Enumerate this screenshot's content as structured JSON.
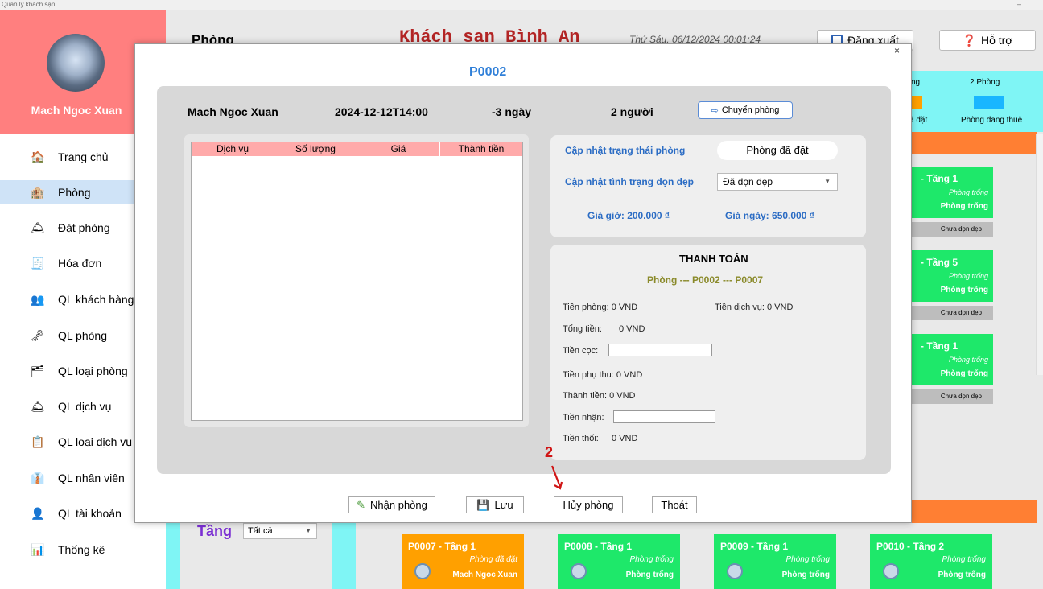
{
  "window": {
    "title": "Quản lý khách sạn",
    "minimize": "–"
  },
  "profile": {
    "name": "Mach Ngoc Xuan"
  },
  "sidebar": {
    "items": [
      {
        "label": "Trang chủ",
        "icon": "home-icon",
        "glyph": "🏠"
      },
      {
        "label": "Phòng",
        "icon": "room-icon",
        "glyph": "🏨"
      },
      {
        "label": "Đặt phòng",
        "icon": "booking-icon",
        "glyph": "🛎"
      },
      {
        "label": "Hóa đơn",
        "icon": "invoice-icon",
        "glyph": "🧾"
      },
      {
        "label": "QL khách hàng",
        "icon": "customers-icon",
        "glyph": "👥"
      },
      {
        "label": "QL phòng",
        "icon": "manage-rooms-icon",
        "glyph": "🗝"
      },
      {
        "label": "QL loại phòng",
        "icon": "room-types-icon",
        "glyph": "🗂"
      },
      {
        "label": "QL dịch vụ",
        "icon": "services-icon",
        "glyph": "🛎"
      },
      {
        "label": "QL loại dịch vụ",
        "icon": "service-types-icon",
        "glyph": "📋"
      },
      {
        "label": "QL nhân viên",
        "icon": "staff-icon",
        "glyph": "👔"
      },
      {
        "label": "QL tài khoản",
        "icon": "accounts-icon",
        "glyph": "👤"
      },
      {
        "label": "Thống kê",
        "icon": "stats-icon",
        "glyph": "📊"
      }
    ],
    "active_index": 1
  },
  "header": {
    "title": "Phòng",
    "hotel": "Khách san Bình An",
    "datetime": "Thứ Sáu, 06/12/2024 00:01:24",
    "logout": "Đăng xuất",
    "help": "Hỗ trợ"
  },
  "legend": {
    "label1": "ng",
    "label2": "2 Phòng",
    "label3": "ã đặt",
    "label4": "Phòng đang thuê",
    "color_booked": "#ffa000",
    "color_rented": "#19b6ff"
  },
  "right_cards": [
    {
      "title": "- Tầng 1",
      "status": "Phòng trống",
      "state": "Phòng trống",
      "clean": "Chưa dọn dẹp"
    },
    {
      "title": "- Tầng 5",
      "status": "Phòng trống",
      "state": "Phòng trống",
      "clean": "Chưa dọn dẹp"
    },
    {
      "title": "- Tầng 1",
      "status": "Phòng trống",
      "state": "Phòng trống",
      "clean": "Chưa dọn dẹp"
    }
  ],
  "floor_filter": {
    "label": "Tầng",
    "value": "Tất cả"
  },
  "bottom_cards": [
    {
      "title": "P0007 - Tầng 1",
      "status": "Phòng đã đặt",
      "name": "Mach Ngoc Xuan",
      "color": "#ffa000"
    },
    {
      "title": "P0008 - Tầng 1",
      "status": "Phòng trống",
      "name": "Phòng trống",
      "color": "#1ee86a"
    },
    {
      "title": "P0009 - Tầng 1",
      "status": "Phòng trống",
      "name": "Phòng trống",
      "color": "#1ee86a"
    },
    {
      "title": "P0010 - Tầng 2",
      "status": "Phòng trống",
      "name": "Phòng trống",
      "color": "#1ee86a"
    }
  ],
  "modal": {
    "close": "×",
    "title": "P0002",
    "guest": "Mach Ngoc Xuan",
    "checkout": "2024-12-12T14:00",
    "days": "-3 ngày",
    "people": "2 người",
    "transfer": "Chuyển phòng",
    "table_headers": [
      "Dịch vụ",
      "Số lượng",
      "Giá",
      "Thành tiền"
    ],
    "status_label": "Cập nhật trạng thái phòng",
    "status_value": "Phòng đã đặt",
    "clean_label": "Cập nhật tình trạng dọn dẹp",
    "clean_value": "Đã dọn dẹp",
    "hour_price": "Giá giờ: 200.000 ₫",
    "day_price": "Giá ngày: 650.000 ₫",
    "pay_title": "THANH TOÁN",
    "pay_rooms": "Phòng --- P0002 --- P0007",
    "room_fee": "Tiền phòng:  0 VND",
    "service_fee": "Tiền dịch vụ:  0 VND",
    "total": "Tổng tiền:",
    "total_value": "0 VND",
    "deposit": "Tiền cọc:",
    "surcharge": "Tiền phụ thu: 0 VND",
    "grand": "Thành tiền: 0 VND",
    "received": "Tiền nhận:",
    "change": "Tiền thối:",
    "change_value": "0 VND",
    "btn_checkin": "Nhận phòng",
    "btn_save": "Lưu",
    "btn_cancel": "Hủy phòng",
    "btn_exit": "Thoát"
  },
  "annotation": {
    "number": "2"
  }
}
